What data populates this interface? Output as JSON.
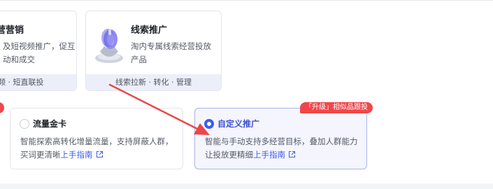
{
  "cards": [
    {
      "title": "营营销",
      "desc": "及短视频推广，促互动和成交",
      "footer": "频 · 短直联投"
    },
    {
      "title": "线索推广",
      "desc": "淘内专属线索经营投放产品",
      "footer": "线索拉新 · 转化 · 管理",
      "icon": "leads-funnel-icon"
    }
  ],
  "options": [
    {
      "title": "流量金卡",
      "desc": "智能探索高转化增量流量，支持屏蔽人群，买词更清晰",
      "guide_label": "上手指南",
      "selected": false
    },
    {
      "title": "自定义推广",
      "desc": "智能与手动支持多经营目标，叠加人群能力让投放更精细",
      "guide_label": "上手指南",
      "selected": true,
      "badge": "「升级」相似品跟投"
    }
  ],
  "colors": {
    "accent": "#3b5cf0",
    "badge_red": "#f0464b",
    "arrow_red": "#e8474b"
  }
}
